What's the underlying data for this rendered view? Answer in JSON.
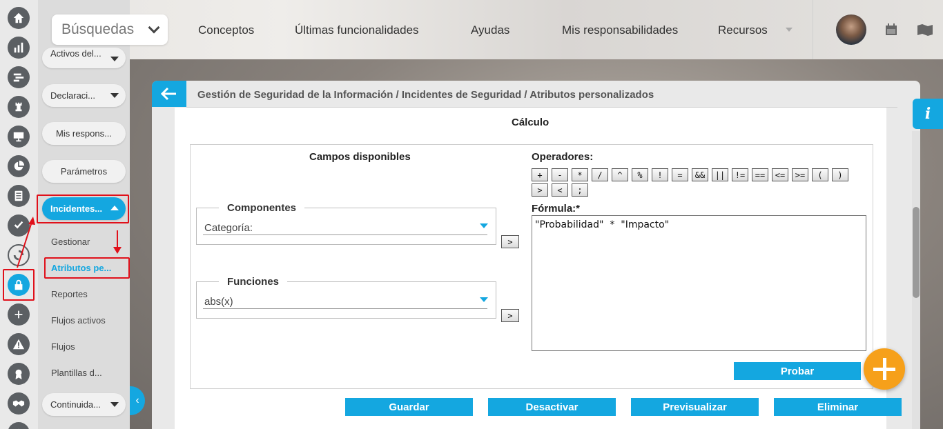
{
  "topbar": {
    "search_label": "Búsquedas",
    "nav": [
      "Conceptos",
      "Últimas funcionalidades",
      "Ayudas",
      "Mis responsabilidades",
      "Recursos"
    ]
  },
  "sidebar": {
    "pills": {
      "cut_top": "Activos del...",
      "declaraciones": "Declaraci...",
      "mis_respons": "Mis respons...",
      "parametros": "Parámetros",
      "incidentes": "Incidentes...",
      "continuidad": "Continuida..."
    },
    "links": [
      "Gestionar",
      "Atributos pe...",
      "Reportes",
      "Flujos activos",
      "Flujos",
      "Plantillas d..."
    ]
  },
  "panel": {
    "breadcrumb": "Gestión de Seguridad de la Información / Incidentes de Seguridad / Atributos personalizados",
    "title": "Cálculo",
    "fields_header": "Campos disponibles",
    "componentes": {
      "legend": "Componentes",
      "value": "Categoría:"
    },
    "funciones": {
      "legend": "Funciones",
      "value": "abs(x)"
    },
    "add_symbol": ">",
    "operators_label": "Operadores:",
    "operators": [
      "+",
      "-",
      "*",
      "/",
      "^",
      "%",
      "!",
      "=",
      "&&",
      "||",
      "!=",
      "==",
      "<=",
      ">=",
      "(",
      ")",
      ">",
      "<",
      ";"
    ],
    "formula_label": "Fórmula:*",
    "formula": "\"Probabilidad\"  *  \"Impacto\"",
    "probar": "Probar",
    "actions": [
      "Guardar",
      "Desactivar",
      "Previsualizar",
      "Eliminar"
    ]
  },
  "info_symbol": "i",
  "colors": {
    "accent": "#14a7e0",
    "fab": "#f6a01a",
    "highlight": "#e0101a"
  }
}
